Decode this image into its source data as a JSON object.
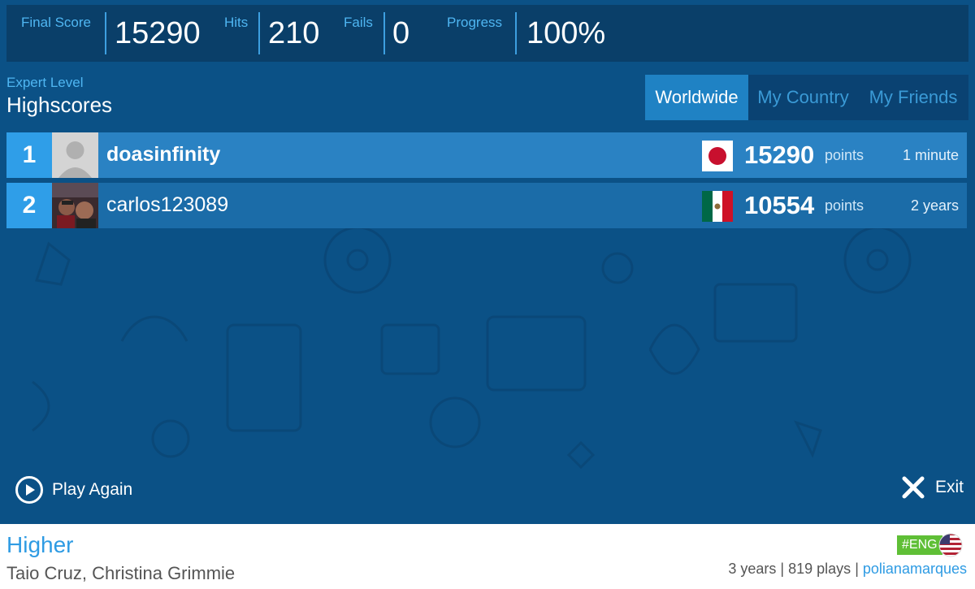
{
  "stats": [
    {
      "label": "Final Score",
      "value": "15290"
    },
    {
      "label": "Hits",
      "value": "210"
    },
    {
      "label": "Fails",
      "value": "0"
    },
    {
      "label": "Progress",
      "value": "100%"
    }
  ],
  "header": {
    "level": "Expert Level",
    "title": "Highscores"
  },
  "tabs": [
    {
      "label": "Worldwide",
      "active": true
    },
    {
      "label": "My Country",
      "active": false
    },
    {
      "label": "My Friends",
      "active": false
    }
  ],
  "scores": [
    {
      "rank": "1",
      "name": "doasinfinity",
      "country_flag": "japan-flag",
      "points": "15290",
      "points_label": "points",
      "when": "1 minute"
    },
    {
      "rank": "2",
      "name": "carlos123089",
      "country_flag": "mexico-flag",
      "points": "10554",
      "points_label": "points",
      "when": "2 years"
    }
  ],
  "actions": {
    "play_again": "Play Again",
    "exit": "Exit"
  },
  "song": {
    "title": "Higher",
    "artist": "Taio Cruz, Christina Grimmie",
    "language_tag": "#ENG",
    "age": "3 years",
    "plays": "819 plays",
    "separator": "|",
    "uploader": "polianamarques"
  },
  "colors": {
    "background": "#0b5186",
    "accent": "#2f9ee8",
    "label": "#4fb6f2",
    "link": "#2e9be3",
    "tag_green": "#5fbf36"
  },
  "icons": {
    "play": "play-circle-icon",
    "exit": "close-x-icon",
    "language": "us-flag-icon",
    "avatar_default": "default-avatar-icon"
  }
}
